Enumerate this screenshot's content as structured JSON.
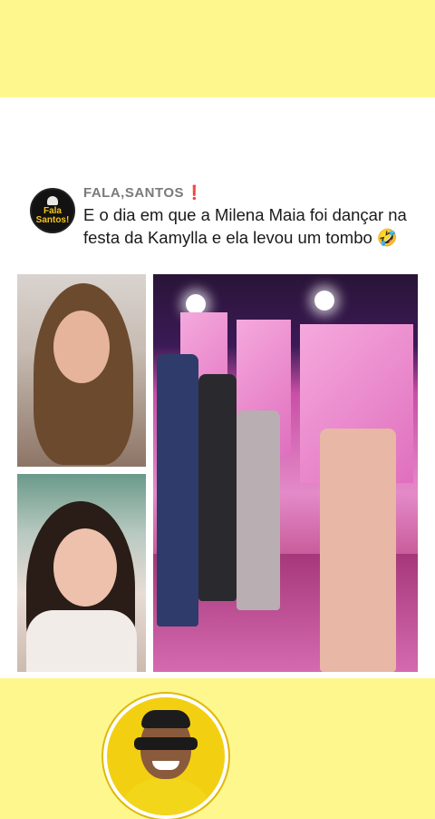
{
  "post": {
    "handle": "FALA,SANTOS",
    "handle_mark": "❗",
    "avatar_text_line1": "Fala",
    "avatar_text_line2": "Santos!",
    "caption": "E o dia em que a Milena Maia foi dançar na festa da Kamylla e ela levou um tombo 🤣"
  },
  "colors": {
    "background": "#fdf78e",
    "card": "#ffffff",
    "handle": "#7a7a7a",
    "accent_yellow": "#f3cf12"
  }
}
